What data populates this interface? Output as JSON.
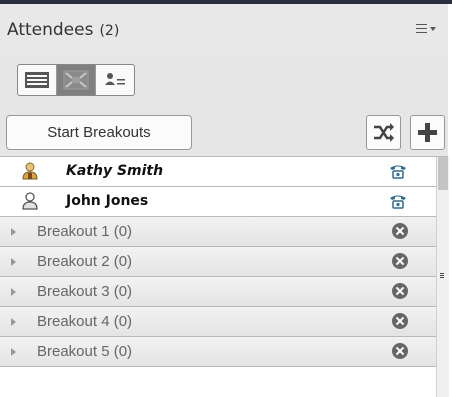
{
  "header": {
    "title": "Attendees",
    "count": "(2)",
    "menu_icon": "menu-lines-icon"
  },
  "view_modes": [
    {
      "icon": "list-view-icon",
      "active": false
    },
    {
      "icon": "breakout-view-icon",
      "active": true
    },
    {
      "icon": "status-view-icon",
      "active": false
    }
  ],
  "actions": {
    "start_label": "Start Breakouts",
    "shuffle_icon": "shuffle-icon",
    "add_icon": "plus-icon"
  },
  "attendees": [
    {
      "name": "Kathy Smith",
      "role": "host",
      "icon": "host-user-icon",
      "phone_icon": "phone-icon"
    },
    {
      "name": "John Jones",
      "role": "participant",
      "icon": "user-icon",
      "phone_icon": "phone-icon"
    }
  ],
  "breakouts": [
    {
      "label": "Breakout 1 (0)"
    },
    {
      "label": "Breakout 2 (0)"
    },
    {
      "label": "Breakout 3 (0)"
    },
    {
      "label": "Breakout 4 (0)"
    },
    {
      "label": "Breakout 5 (0)"
    }
  ],
  "colors": {
    "accent_dark": "#2b3040",
    "host_icon": "#d9a441",
    "phone_icon": "#2f6b8e"
  }
}
